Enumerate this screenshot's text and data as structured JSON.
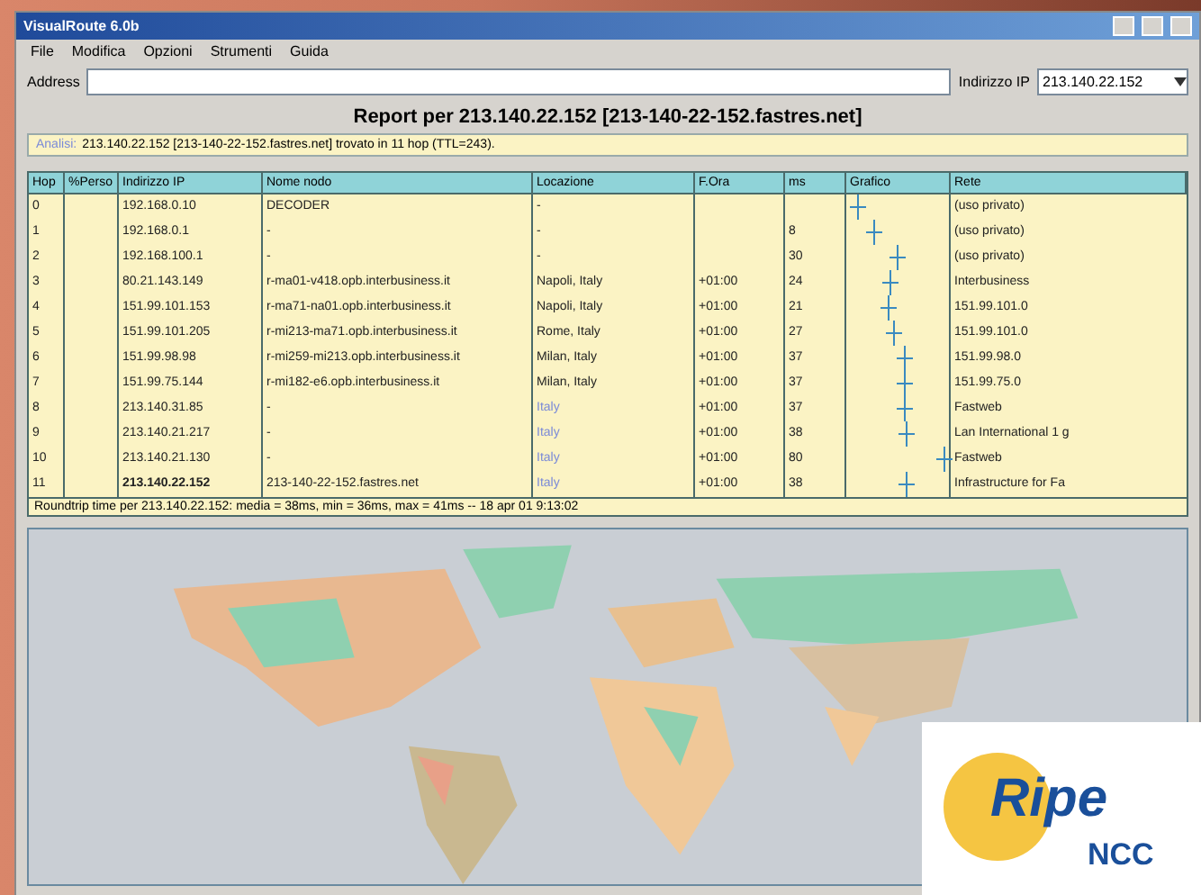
{
  "window": {
    "title": "VisualRoute 6.0b"
  },
  "menu": [
    "File",
    "Modifica",
    "Opzioni",
    "Strumenti",
    "Guida"
  ],
  "address_bar": {
    "label": "Address",
    "ip_label": "Indirizzo IP",
    "ip_value": "213.140.22.152"
  },
  "report": {
    "title": "Report per 213.140.22.152 [213-140-22-152.fastres.net]",
    "info_label": "Analisi:",
    "info": "213.140.22.152 [213-140-22-152.fastres.net] trovato in 11 hop (TTL=243)."
  },
  "table": {
    "columns": [
      "Hop",
      "%Perso",
      "Indirizzo IP",
      "Nome nodo",
      "Locazione",
      "F.Ora",
      "ms",
      "Grafico",
      "Rete"
    ],
    "rows": [
      {
        "hop": "0",
        "ip": "192.168.0.10",
        "node": "DECODER",
        "location": "-",
        "tz": "",
        "ms": "",
        "network": "(uso privato)"
      },
      {
        "hop": "1",
        "ip": "192.168.0.1",
        "node": "-",
        "location": "-",
        "tz": "",
        "ms": "8",
        "network": "(uso privato)"
      },
      {
        "hop": "2",
        "ip": "192.168.100.1",
        "node": "-",
        "location": "-",
        "tz": "",
        "ms": "30",
        "network": "(uso privato)"
      },
      {
        "hop": "3",
        "ip": "80.21.143.149",
        "node": "r-ma01-v418.opb.interbusiness.it",
        "location": "Napoli, Italy",
        "tz": "+01:00",
        "ms": "24",
        "network": "Interbusiness"
      },
      {
        "hop": "4",
        "ip": "151.99.101.153",
        "node": "r-ma71-na01.opb.interbusiness.it",
        "location": "Napoli, Italy",
        "tz": "+01:00",
        "ms": "21",
        "network": "151.99.101.0"
      },
      {
        "hop": "5",
        "ip": "151.99.101.205",
        "node": "r-mi213-ma71.opb.interbusiness.it",
        "location": "Rome, Italy",
        "tz": "+01:00",
        "ms": "27",
        "network": "151.99.101.0"
      },
      {
        "hop": "6",
        "ip": "151.99.98.98",
        "node": "r-mi259-mi213.opb.interbusiness.it",
        "location": "Milan, Italy",
        "tz": "+01:00",
        "ms": "37",
        "network": "151.99.98.0"
      },
      {
        "hop": "7",
        "ip": "151.99.75.144",
        "node": "r-mi182-e6.opb.interbusiness.it",
        "location": "Milan, Italy",
        "tz": "+01:00",
        "ms": "37",
        "network": "151.99.75.0"
      },
      {
        "hop": "8",
        "ip": "213.140.31.85",
        "node": "-",
        "location": "Italy",
        "tz": "+01:00",
        "ms": "37",
        "network": "Fastweb"
      },
      {
        "hop": "9",
        "ip": "213.140.21.217",
        "node": "-",
        "location": "Italy",
        "tz": "+01:00",
        "ms": "38",
        "network": "Lan International 1 g"
      },
      {
        "hop": "10",
        "ip": "213.140.21.130",
        "node": "-",
        "location": "Italy",
        "tz": "+01:00",
        "ms": "80",
        "network": "Fastweb"
      },
      {
        "hop": "11",
        "ip": "213.140.22.152",
        "node": "213-140-22-152.fastres.net",
        "location": "Italy",
        "tz": "+01:00",
        "ms": "38",
        "network": "Infrastructure for Fa"
      }
    ],
    "status": "Roundtrip time per 213.140.22.152: media = 38ms, min = 36ms, max = 41ms -- 18 apr 01 9:13:02"
  },
  "logo": {
    "word": "Ripe",
    "sub": "NCC"
  }
}
